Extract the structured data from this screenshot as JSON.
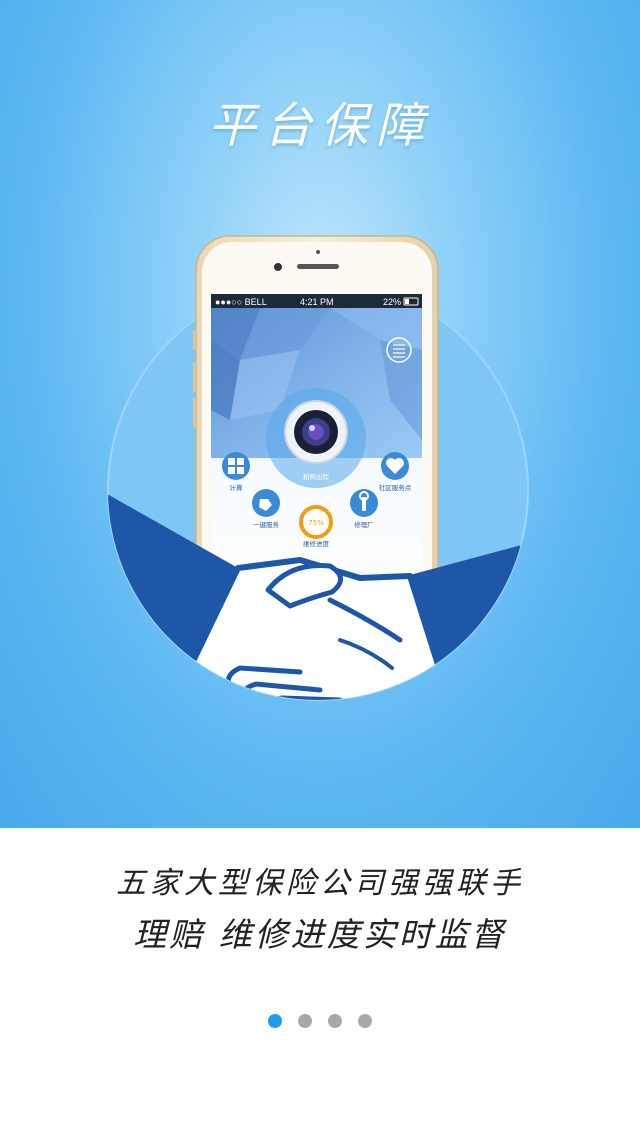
{
  "hero": {
    "title": "平台保障"
  },
  "phone": {
    "status_bar": {
      "carrier": "●●●○○ BELL",
      "time": "4:21 PM",
      "battery": "22%"
    },
    "app": {
      "camera_button_label": "拍照出险",
      "features": [
        {
          "label": "计算",
          "icon": "calculator-icon"
        },
        {
          "label": "社区服务点",
          "icon": "heart-icon"
        },
        {
          "label": "一键服务",
          "icon": "hand-pointer-icon"
        },
        {
          "label": "修理厂",
          "icon": "wrench-icon"
        },
        {
          "label": "维修进度",
          "icon": "progress-icon"
        }
      ],
      "progress_value": "75%"
    }
  },
  "caption": {
    "line1": "五家大型保险公司强强联手",
    "line2": "理赔 维修进度实时监督"
  },
  "pager": {
    "total": 4,
    "active_index": 0
  },
  "colors": {
    "accent": "#1f9ceb",
    "hero_blue": "#4aa9ec",
    "circle_blue": "#7ec6f5",
    "sleeve_blue": "#1f57a8",
    "progress_orange": "#f39c12"
  }
}
